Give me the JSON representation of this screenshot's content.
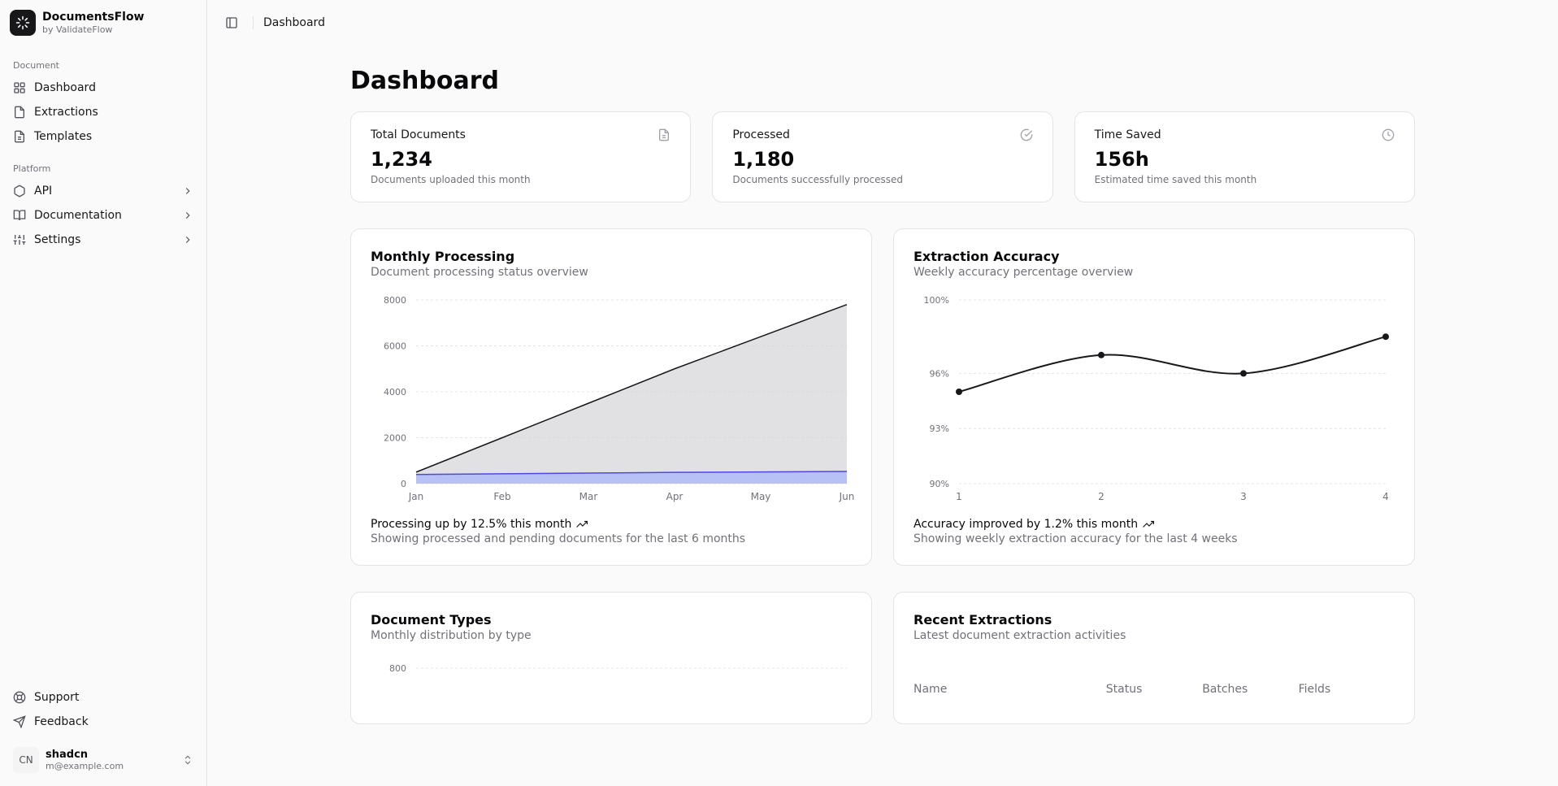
{
  "brand": {
    "name": "DocumentsFlow",
    "by": "by ValidateFlow"
  },
  "nav": {
    "doc_label": "Document",
    "dashboard": "Dashboard",
    "extractions": "Extractions",
    "templates": "Templates",
    "platform_label": "Platform",
    "api": "API",
    "documentation": "Documentation",
    "settings": "Settings",
    "support": "Support",
    "feedback": "Feedback"
  },
  "user": {
    "initials": "CN",
    "name": "shadcn",
    "email": "m@example.com"
  },
  "breadcrumb": "Dashboard",
  "page_title": "Dashboard",
  "stats": {
    "total": {
      "label": "Total Documents",
      "value": "1,234",
      "desc": "Documents uploaded this month"
    },
    "processed": {
      "label": "Processed",
      "value": "1,180",
      "desc": "Documents successfully processed"
    },
    "time": {
      "label": "Time Saved",
      "value": "156h",
      "desc": "Estimated time saved this month"
    }
  },
  "monthly": {
    "title": "Monthly Processing",
    "sub": "Document processing status overview",
    "foot": "Processing up by 12.5% this month",
    "foot_sub": "Showing processed and pending documents for the last 6 months"
  },
  "accuracy": {
    "title": "Extraction Accuracy",
    "sub": "Weekly accuracy percentage overview",
    "foot": "Accuracy improved by 1.2% this month",
    "foot_sub": "Showing weekly extraction accuracy for the last 4 weeks"
  },
  "doctypes": {
    "title": "Document Types",
    "sub": "Monthly distribution by type"
  },
  "recent": {
    "title": "Recent Extractions",
    "sub": "Latest document extraction activities",
    "cols": {
      "name": "Name",
      "status": "Status",
      "batches": "Batches",
      "fields": "Fields"
    }
  },
  "chart_data": [
    {
      "type": "area",
      "title": "Monthly Processing",
      "categories": [
        "Jan",
        "Feb",
        "Mar",
        "Apr",
        "May",
        "Jun"
      ],
      "series": [
        {
          "name": "processed",
          "values": [
            500,
            2000,
            3500,
            5000,
            6400,
            7800
          ]
        },
        {
          "name": "pending",
          "values": [
            400,
            430,
            460,
            490,
            510,
            530
          ]
        }
      ],
      "ylim": [
        0,
        8000
      ],
      "yticks": [
        0,
        2000,
        4000,
        6000,
        8000
      ],
      "xlabel": "",
      "ylabel": ""
    },
    {
      "type": "line",
      "title": "Extraction Accuracy",
      "x": [
        1,
        2,
        3,
        4
      ],
      "series": [
        {
          "name": "accuracy",
          "values": [
            95,
            97,
            96,
            98
          ]
        }
      ],
      "ylim": [
        90,
        100
      ],
      "yticks": [
        90,
        93,
        96,
        100
      ],
      "xlabel": "",
      "ylabel": ""
    },
    {
      "type": "bar",
      "title": "Document Types",
      "ylim": [
        0,
        800
      ],
      "yticks": [
        800
      ],
      "categories": [],
      "series": []
    }
  ]
}
